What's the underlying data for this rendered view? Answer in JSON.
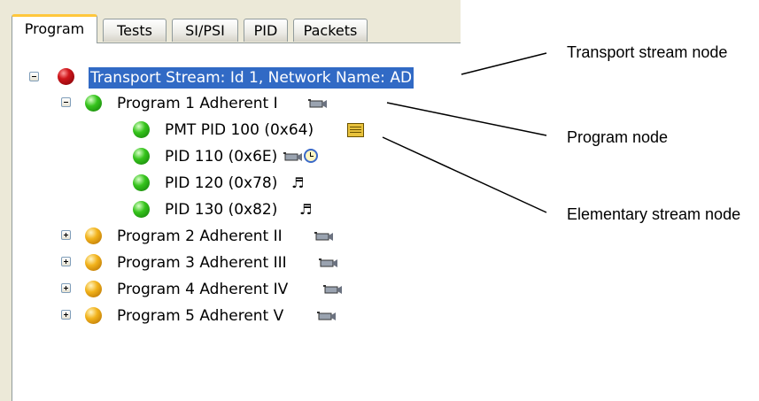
{
  "tabs": [
    "Program",
    "Tests",
    "SI/PSI",
    "PID",
    "Packets"
  ],
  "tree": {
    "transport_stream": "Transport Stream: Id 1, Network Name: AD",
    "program1": "Program 1 Adherent I",
    "pmt": "PMT PID 100 (0x64)",
    "pid110": "PID 110 (0x6E)",
    "pid120": "PID 120 (0x78)",
    "pid130": "PID 130 (0x82)",
    "program2": "Program 2 Adherent II",
    "program3": "Program 3 Adherent III",
    "program4": "Program 4 Adherent IV",
    "program5": "Program 5 Adherent V"
  },
  "callouts": {
    "transport_stream_node": "Transport stream node",
    "program_node": "Program node",
    "elementary_stream_node": "Elementary stream node"
  },
  "colors": {
    "selection": "#316ac5",
    "tab_highlight": "#ffc73c",
    "status_red": "#d0161b",
    "status_green": "#36c41c",
    "status_amber": "#f2b31c"
  },
  "icons": {
    "video": "camera-icon",
    "audio": "music-note-icon",
    "pmt": "table-icon",
    "pcr": "clock-icon"
  }
}
